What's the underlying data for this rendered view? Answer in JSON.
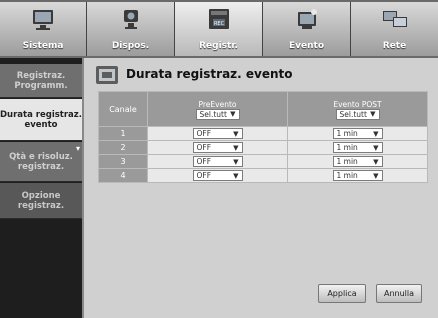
{
  "top_tabs": [
    {
      "label": "Sistema",
      "icon": "monitor-icon"
    },
    {
      "label": "Dispos.",
      "icon": "camera-icon"
    },
    {
      "label": "Registr.",
      "icon": "record-icon"
    },
    {
      "label": "Evento",
      "icon": "event-icon"
    },
    {
      "label": "Rete",
      "icon": "network-icon"
    }
  ],
  "active_tab": "Registr.",
  "sidebar": {
    "items": [
      {
        "label": "Registraz. Programm."
      },
      {
        "label": "Durata registraz. evento"
      },
      {
        "label": "Qtà e risoluz. registraz."
      },
      {
        "label": "Opzione registraz."
      }
    ],
    "active_item": "Durata registraz. evento"
  },
  "main": {
    "title": "Durata registraz. evento",
    "columns": {
      "channel": "Canale",
      "pre_event": "PreEvento",
      "post_event": "Evento POST"
    },
    "select_all_label": "Sel.tutt",
    "rows": [
      {
        "channel": "1",
        "pre": "OFF",
        "post": "1 min"
      },
      {
        "channel": "2",
        "pre": "OFF",
        "post": "1 min"
      },
      {
        "channel": "3",
        "pre": "OFF",
        "post": "1 min"
      },
      {
        "channel": "4",
        "pre": "OFF",
        "post": "1 min"
      }
    ],
    "apply_label": "Applica",
    "cancel_label": "Annulla"
  },
  "colors": {
    "active_tab_bg": "#efefef",
    "sidebar_active_bg": "#e6e6e6",
    "panel_bg": "#d0d0d0"
  }
}
